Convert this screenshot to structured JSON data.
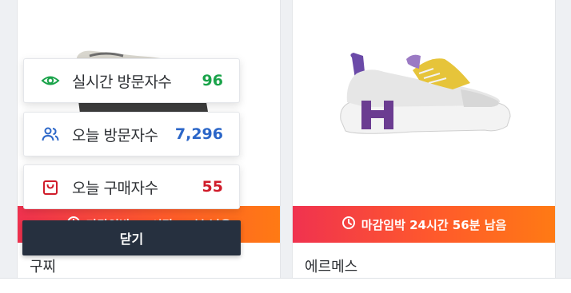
{
  "colors": {
    "visitors_live": "#1aa34a",
    "visitors_today": "#2b66c8",
    "buyers_today": "#d01c2a",
    "deadline_gradient_start": "#f0324f",
    "deadline_gradient_end": "#ff7a14",
    "close_button": "#26303f"
  },
  "products": [
    {
      "brand": "구찌",
      "deadline": "마감임박 24시간 56분 남음",
      "icon": "clock-icon"
    },
    {
      "brand": "에르메스",
      "deadline": "마감임박 24시간 56분 남음",
      "icon": "clock-icon"
    }
  ],
  "stats": {
    "live_visitors": {
      "label": "실시간 방문자수",
      "value": "96",
      "icon": "eye-icon"
    },
    "today_visitors": {
      "label": "오늘 방문자수",
      "value": "7,296",
      "icon": "users-icon"
    },
    "today_buyers": {
      "label": "오늘 구매자수",
      "value": "55",
      "icon": "shopping-bag-icon"
    }
  },
  "close_button": {
    "label": "닫기"
  }
}
